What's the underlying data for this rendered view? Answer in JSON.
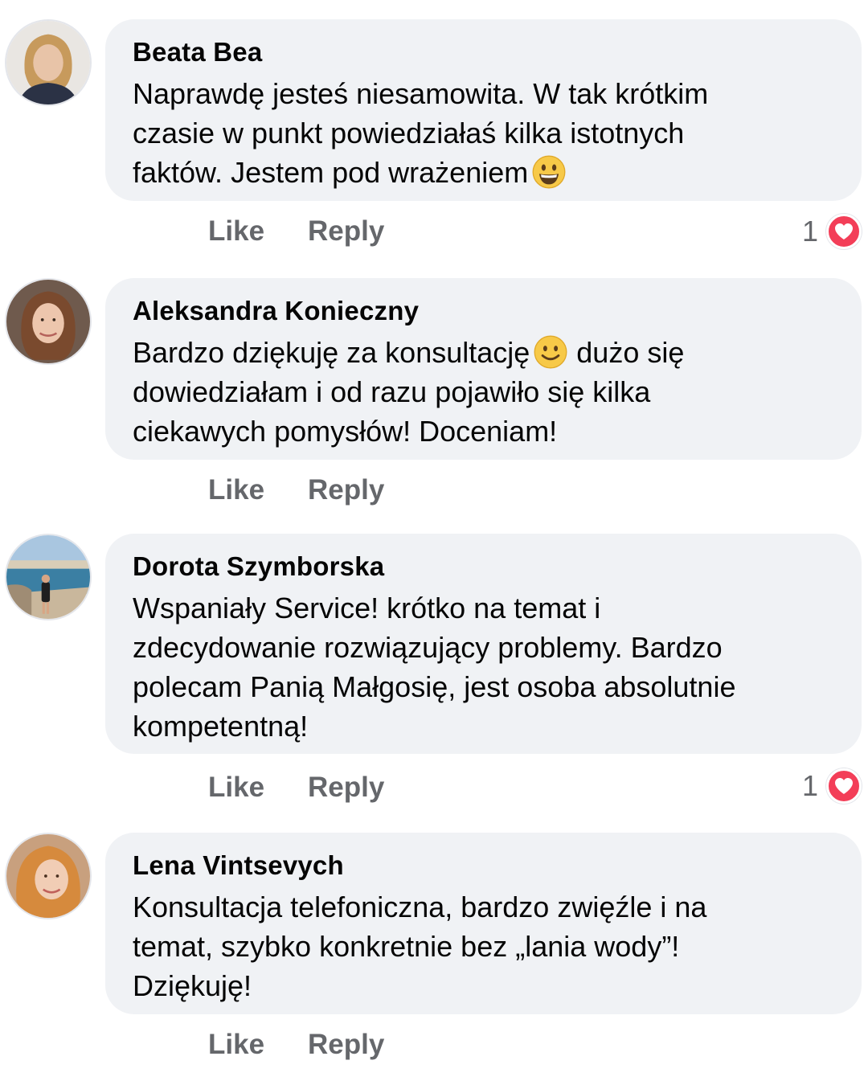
{
  "colors": {
    "bubble": "#f0f2f5",
    "action_text": "#65676b",
    "heart_reaction": "#f33e58"
  },
  "comments": [
    {
      "author": "Beata Bea",
      "text": "Naprawdę jesteś niesamowita. W tak krótkim\nczasie w punkt powiedziałaś kilka istotnych\nfaktów. Jestem pod wrażeniem",
      "emoji": "grinning-face-icon",
      "like": "Like",
      "reply": "Reply",
      "reaction_count": "1",
      "reaction_icon": "heart-reaction-icon"
    },
    {
      "author": "Aleksandra Konieczny",
      "text_before_emoji": "Bardzo dziękuję za konsultację",
      "emoji": "smiling-face-icon",
      "text_after_emoji": " dużo się\ndowiedziałam i od razu pojawiło się kilka\nciekawych pomysłów! Doceniam!",
      "like": "Like",
      "reply": "Reply"
    },
    {
      "author": "Dorota Szymborska",
      "text": "Wspaniały Service! krótko na temat i\nzdecydowanie rozwiązujący problemy. Bardzo\npolecam Panią Małgosię, jest osoba absolutnie\nkompetentną!",
      "like": "Like",
      "reply": "Reply",
      "reaction_count": "1",
      "reaction_icon": "heart-reaction-icon"
    },
    {
      "author": "Lena Vintsevych",
      "text": "Konsultacja telefoniczna, bardzo zwięźle i na\ntemat, szybko konkretnie bez „lania wody”!\nDziękuję!",
      "like": "Like",
      "reply": "Reply"
    }
  ]
}
